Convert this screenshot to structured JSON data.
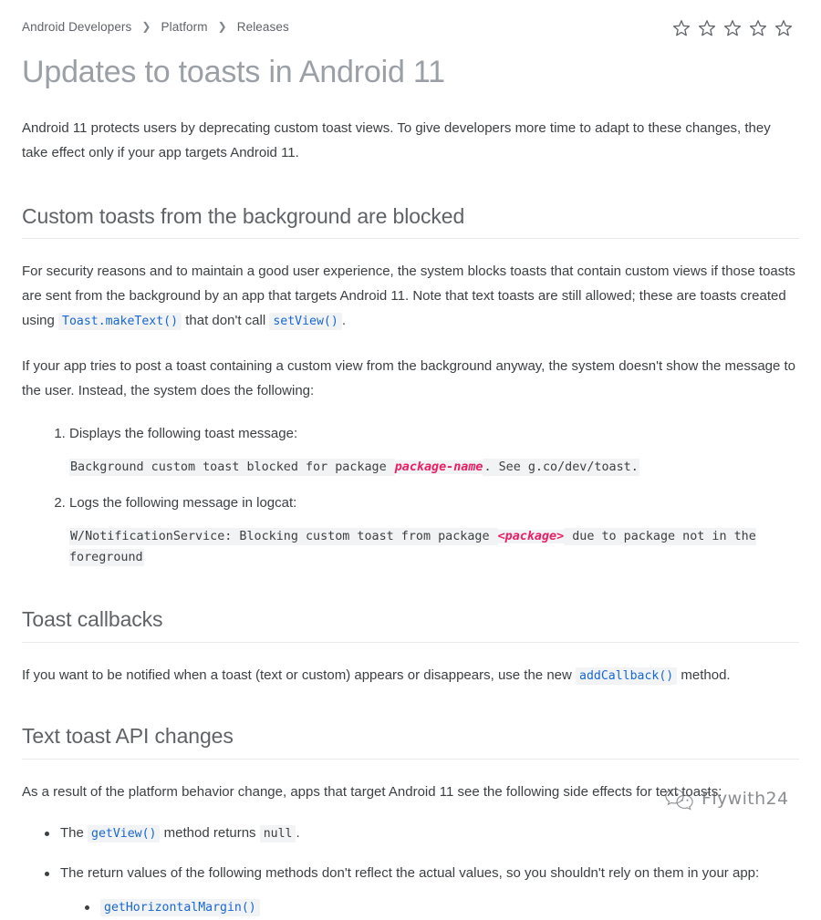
{
  "breadcrumb": {
    "items": [
      {
        "label": "Android Developers"
      },
      {
        "label": "Platform"
      },
      {
        "label": "Releases"
      }
    ],
    "separator": "❯"
  },
  "rating": {
    "stars": 5,
    "filled": 0,
    "icon": "star-outline-icon"
  },
  "header": {
    "title": "Updates to toasts in Android 11"
  },
  "intro": {
    "paragraph": "Android 11 protects users by deprecating custom toast views. To give developers more time to adapt to these changes, they take effect only if your app targets Android 11."
  },
  "sections": [
    {
      "id": "custom-toasts-blocked",
      "heading": "Custom toasts from the background are blocked",
      "p1_a": "For security reasons and to maintain a good user experience, the system blocks toasts that contain custom views if those toasts are sent from the background by an app that targets Android 11. Note that text toasts are still allowed; these are toasts created using ",
      "p1_code1": "Toast.makeText()",
      "p1_b": " that don't call ",
      "p1_code2": "setView()",
      "p1_c": ".",
      "p2": "If your app tries to post a toast containing a custom view from the background anyway, the system doesn't show the message to the user. Instead, the system does the following:",
      "steps": [
        {
          "text": "Displays the following toast message:",
          "code": {
            "before": "Background custom toast blocked for package ",
            "variable": "package-name",
            "after": ". See g.co/dev/toast."
          }
        },
        {
          "text": "Logs the following message in logcat:",
          "code": {
            "before": "W/NotificationService: Blocking custom toast from package ",
            "variable": "<package>",
            "after": " due to package not in the foreground"
          }
        }
      ]
    },
    {
      "id": "toast-callbacks",
      "heading": "Toast callbacks",
      "p1_a": "If you want to be notified when a toast (text or custom) appears or disappears, use the new ",
      "p1_code1": "addCallback()",
      "p1_b": " method."
    },
    {
      "id": "text-toast-api-changes",
      "heading": "Text toast API changes",
      "p1": "As a result of the platform behavior change, apps that target Android 11 see the following side effects for text toasts:",
      "bullets": [
        {
          "before": "The ",
          "code1": "getView()",
          "middle": " method returns ",
          "code2": "null",
          "after": "."
        },
        {
          "before": "The return values of the following methods don't reflect the actual values, so you shouldn't rely on them in your app:",
          "subbullets": [
            {
              "code": "getHorizontalMargin()"
            }
          ]
        }
      ]
    }
  ],
  "watermark": {
    "text": "Flywith24",
    "logo": "wechat-bubble-icon"
  },
  "colors": {
    "code_blue": "#1967d2",
    "code_bg": "#f1f3f4",
    "variable_pink": "#e91e63",
    "title_gray": "#9aa0a6",
    "heading_gray": "#5f6368",
    "body_gray": "#3c4043",
    "rule_gray": "#e8eaed"
  }
}
